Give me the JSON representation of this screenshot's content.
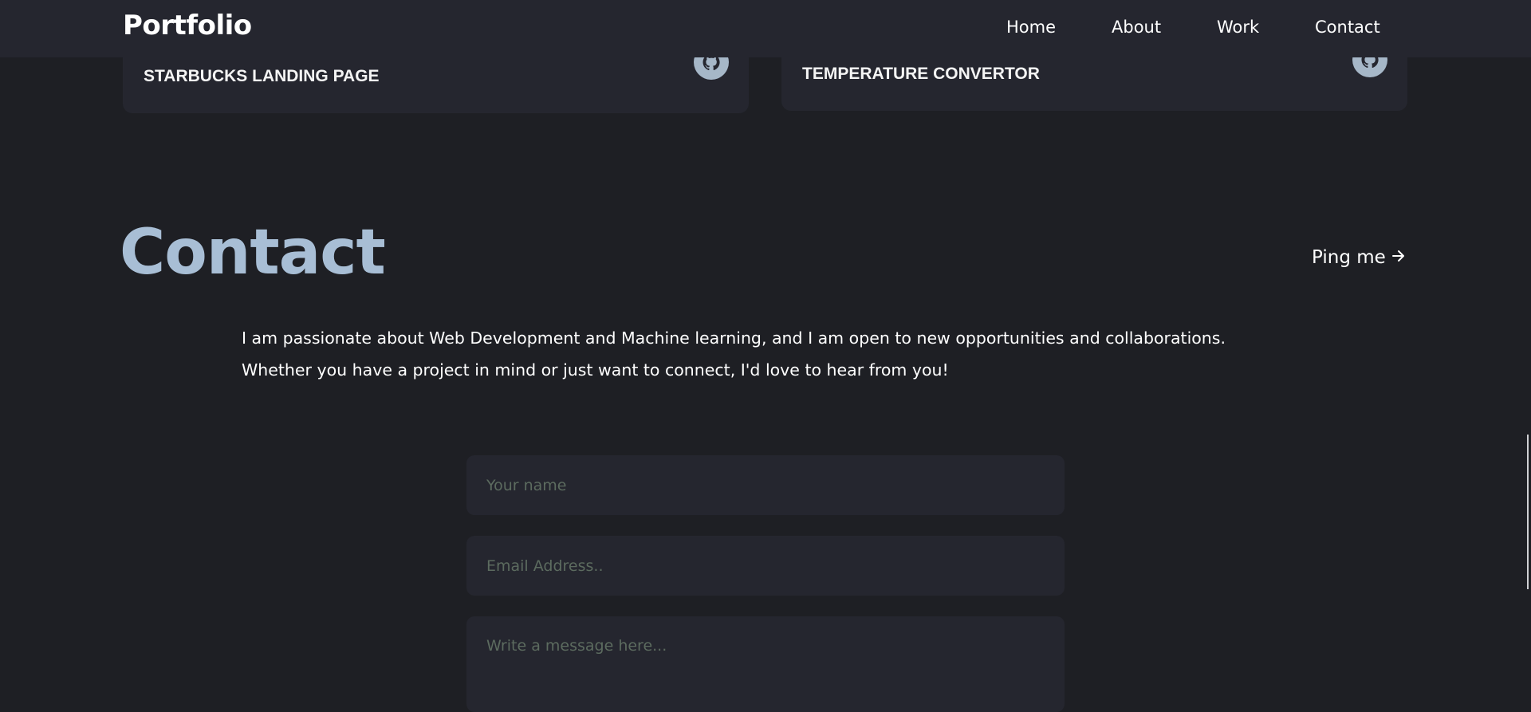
{
  "navbar": {
    "brand": "Portfolio",
    "links": [
      "Home",
      "About",
      "Work",
      "Contact"
    ]
  },
  "projects": [
    {
      "title": "STARBUCKS LANDING PAGE",
      "link_icon": "github-icon"
    },
    {
      "title": "TEMPERATURE CONVERTOR",
      "link_icon": "github-icon"
    }
  ],
  "contact": {
    "title": "Contact",
    "ping_label": "Ping me",
    "ping_icon": "arrow-right-icon",
    "intro": "I am passionate about Web Development and Machine learning, and I am open to new opportunities and collaborations. Whether you have a project in mind or just want to connect, I'd love to hear from you!",
    "form": {
      "name_placeholder": "Your name",
      "email_placeholder": "Email Address..",
      "message_placeholder": "Write a message here..."
    }
  },
  "colors": {
    "background": "#1e1f24",
    "surface": "#25262f",
    "accent": "#a8bed5",
    "placeholder": "#5c6b5f"
  }
}
